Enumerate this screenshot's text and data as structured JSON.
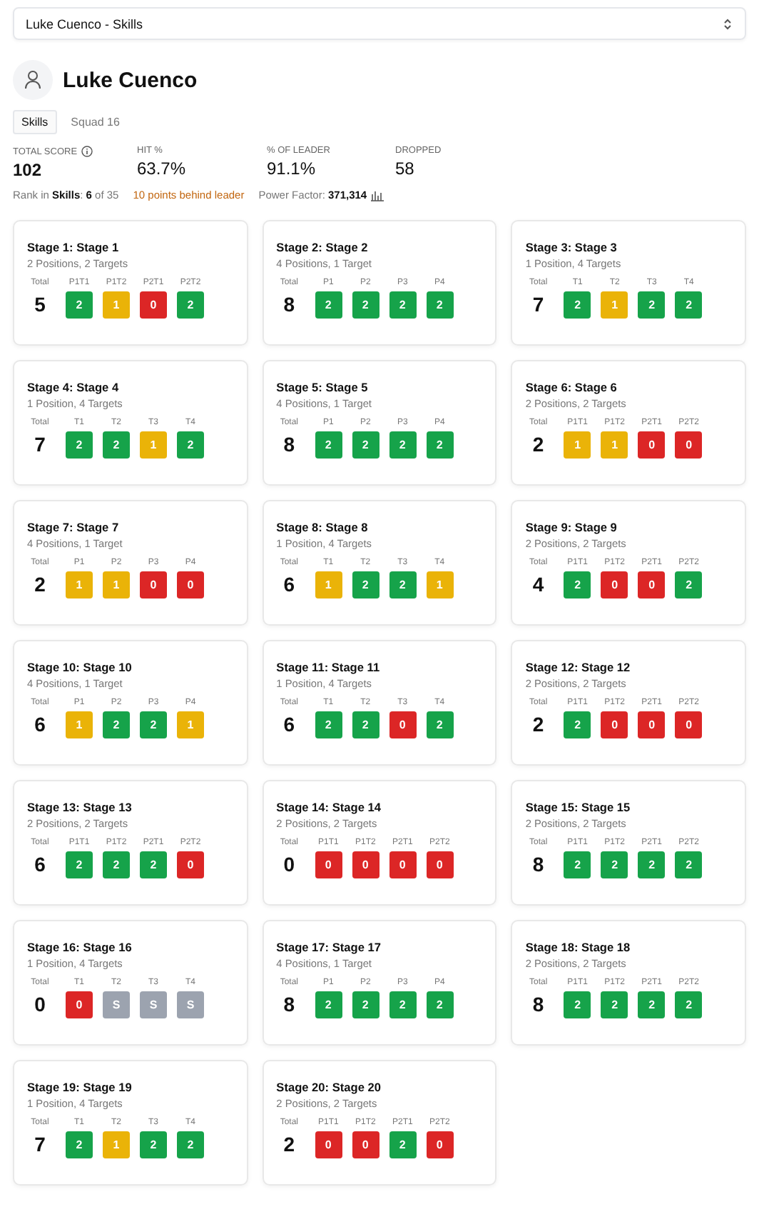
{
  "selector": {
    "value": "Luke Cuenco - Skills"
  },
  "shooter": {
    "name": "Luke Cuenco"
  },
  "tabs": [
    {
      "label": "Skills",
      "selected": true
    },
    {
      "label": "Squad 16",
      "selected": false
    }
  ],
  "stats": [
    {
      "label": "TOTAL SCORE",
      "value": "102",
      "info": true
    },
    {
      "label": "HIT %",
      "value": "63.7%",
      "info": false
    },
    {
      "label": "% OF LEADER",
      "value": "91.1%",
      "info": false
    },
    {
      "label": "DROPPED",
      "value": "58",
      "info": false
    }
  ],
  "rank": {
    "prefix": "Rank in ",
    "division": "Skills",
    "sep": ": ",
    "place": "6",
    "of": " of 35"
  },
  "behind": "10 points behind leader",
  "power_factor": {
    "label": "Power Factor: ",
    "value": "371,314"
  },
  "stages": [
    {
      "title": "Stage 1: Stage 1",
      "subtitle": "2 Positions, 2 Targets",
      "total_label": "Total",
      "total": "5",
      "scores": [
        {
          "label": "P1T1",
          "value": "2",
          "color": "#16a34a"
        },
        {
          "label": "P1T2",
          "value": "1",
          "color": "#eab308"
        },
        {
          "label": "P2T1",
          "value": "0",
          "color": "#dc2626"
        },
        {
          "label": "P2T2",
          "value": "2",
          "color": "#16a34a"
        }
      ]
    },
    {
      "title": "Stage 2: Stage 2",
      "subtitle": "4 Positions, 1 Target",
      "total_label": "Total",
      "total": "8",
      "scores": [
        {
          "label": "P1",
          "value": "2",
          "color": "#16a34a"
        },
        {
          "label": "P2",
          "value": "2",
          "color": "#16a34a"
        },
        {
          "label": "P3",
          "value": "2",
          "color": "#16a34a"
        },
        {
          "label": "P4",
          "value": "2",
          "color": "#16a34a"
        }
      ]
    },
    {
      "title": "Stage 3: Stage 3",
      "subtitle": "1 Position, 4 Targets",
      "total_label": "Total",
      "total": "7",
      "scores": [
        {
          "label": "T1",
          "value": "2",
          "color": "#16a34a"
        },
        {
          "label": "T2",
          "value": "1",
          "color": "#eab308"
        },
        {
          "label": "T3",
          "value": "2",
          "color": "#16a34a"
        },
        {
          "label": "T4",
          "value": "2",
          "color": "#16a34a"
        }
      ]
    },
    {
      "title": "Stage 4: Stage 4",
      "subtitle": "1 Position, 4 Targets",
      "total_label": "Total",
      "total": "7",
      "scores": [
        {
          "label": "T1",
          "value": "2",
          "color": "#16a34a"
        },
        {
          "label": "T2",
          "value": "2",
          "color": "#16a34a"
        },
        {
          "label": "T3",
          "value": "1",
          "color": "#eab308"
        },
        {
          "label": "T4",
          "value": "2",
          "color": "#16a34a"
        }
      ]
    },
    {
      "title": "Stage 5: Stage 5",
      "subtitle": "4 Positions, 1 Target",
      "total_label": "Total",
      "total": "8",
      "scores": [
        {
          "label": "P1",
          "value": "2",
          "color": "#16a34a"
        },
        {
          "label": "P2",
          "value": "2",
          "color": "#16a34a"
        },
        {
          "label": "P3",
          "value": "2",
          "color": "#16a34a"
        },
        {
          "label": "P4",
          "value": "2",
          "color": "#16a34a"
        }
      ]
    },
    {
      "title": "Stage 6: Stage 6",
      "subtitle": "2 Positions, 2 Targets",
      "total_label": "Total",
      "total": "2",
      "scores": [
        {
          "label": "P1T1",
          "value": "1",
          "color": "#eab308"
        },
        {
          "label": "P1T2",
          "value": "1",
          "color": "#eab308"
        },
        {
          "label": "P2T1",
          "value": "0",
          "color": "#dc2626"
        },
        {
          "label": "P2T2",
          "value": "0",
          "color": "#dc2626"
        }
      ]
    },
    {
      "title": "Stage 7: Stage 7",
      "subtitle": "4 Positions, 1 Target",
      "total_label": "Total",
      "total": "2",
      "scores": [
        {
          "label": "P1",
          "value": "1",
          "color": "#eab308"
        },
        {
          "label": "P2",
          "value": "1",
          "color": "#eab308"
        },
        {
          "label": "P3",
          "value": "0",
          "color": "#dc2626"
        },
        {
          "label": "P4",
          "value": "0",
          "color": "#dc2626"
        }
      ]
    },
    {
      "title": "Stage 8: Stage 8",
      "subtitle": "1 Position, 4 Targets",
      "total_label": "Total",
      "total": "6",
      "scores": [
        {
          "label": "T1",
          "value": "1",
          "color": "#eab308"
        },
        {
          "label": "T2",
          "value": "2",
          "color": "#16a34a"
        },
        {
          "label": "T3",
          "value": "2",
          "color": "#16a34a"
        },
        {
          "label": "T4",
          "value": "1",
          "color": "#eab308"
        }
      ]
    },
    {
      "title": "Stage 9: Stage 9",
      "subtitle": "2 Positions, 2 Targets",
      "total_label": "Total",
      "total": "4",
      "scores": [
        {
          "label": "P1T1",
          "value": "2",
          "color": "#16a34a"
        },
        {
          "label": "P1T2",
          "value": "0",
          "color": "#dc2626"
        },
        {
          "label": "P2T1",
          "value": "0",
          "color": "#dc2626"
        },
        {
          "label": "P2T2",
          "value": "2",
          "color": "#16a34a"
        }
      ]
    },
    {
      "title": "Stage 10: Stage 10",
      "subtitle": "4 Positions, 1 Target",
      "total_label": "Total",
      "total": "6",
      "scores": [
        {
          "label": "P1",
          "value": "1",
          "color": "#eab308"
        },
        {
          "label": "P2",
          "value": "2",
          "color": "#16a34a"
        },
        {
          "label": "P3",
          "value": "2",
          "color": "#16a34a"
        },
        {
          "label": "P4",
          "value": "1",
          "color": "#eab308"
        }
      ]
    },
    {
      "title": "Stage 11: Stage 11",
      "subtitle": "1 Position, 4 Targets",
      "total_label": "Total",
      "total": "6",
      "scores": [
        {
          "label": "T1",
          "value": "2",
          "color": "#16a34a"
        },
        {
          "label": "T2",
          "value": "2",
          "color": "#16a34a"
        },
        {
          "label": "T3",
          "value": "0",
          "color": "#dc2626"
        },
        {
          "label": "T4",
          "value": "2",
          "color": "#16a34a"
        }
      ]
    },
    {
      "title": "Stage 12: Stage 12",
      "subtitle": "2 Positions, 2 Targets",
      "total_label": "Total",
      "total": "2",
      "scores": [
        {
          "label": "P1T1",
          "value": "2",
          "color": "#16a34a"
        },
        {
          "label": "P1T2",
          "value": "0",
          "color": "#dc2626"
        },
        {
          "label": "P2T1",
          "value": "0",
          "color": "#dc2626"
        },
        {
          "label": "P2T2",
          "value": "0",
          "color": "#dc2626"
        }
      ]
    },
    {
      "title": "Stage 13: Stage 13",
      "subtitle": "2 Positions, 2 Targets",
      "total_label": "Total",
      "total": "6",
      "scores": [
        {
          "label": "P1T1",
          "value": "2",
          "color": "#16a34a"
        },
        {
          "label": "P1T2",
          "value": "2",
          "color": "#16a34a"
        },
        {
          "label": "P2T1",
          "value": "2",
          "color": "#16a34a"
        },
        {
          "label": "P2T2",
          "value": "0",
          "color": "#dc2626"
        }
      ]
    },
    {
      "title": "Stage 14: Stage 14",
      "subtitle": "2 Positions, 2 Targets",
      "total_label": "Total",
      "total": "0",
      "scores": [
        {
          "label": "P1T1",
          "value": "0",
          "color": "#dc2626"
        },
        {
          "label": "P1T2",
          "value": "0",
          "color": "#dc2626"
        },
        {
          "label": "P2T1",
          "value": "0",
          "color": "#dc2626"
        },
        {
          "label": "P2T2",
          "value": "0",
          "color": "#dc2626"
        }
      ]
    },
    {
      "title": "Stage 15: Stage 15",
      "subtitle": "2 Positions, 2 Targets",
      "total_label": "Total",
      "total": "8",
      "scores": [
        {
          "label": "P1T1",
          "value": "2",
          "color": "#16a34a"
        },
        {
          "label": "P1T2",
          "value": "2",
          "color": "#16a34a"
        },
        {
          "label": "P2T1",
          "value": "2",
          "color": "#16a34a"
        },
        {
          "label": "P2T2",
          "value": "2",
          "color": "#16a34a"
        }
      ]
    },
    {
      "title": "Stage 16: Stage 16",
      "subtitle": "1 Position, 4 Targets",
      "total_label": "Total",
      "total": "0",
      "scores": [
        {
          "label": "T1",
          "value": "0",
          "color": "#dc2626"
        },
        {
          "label": "T2",
          "value": "S",
          "color": "#9ca3af"
        },
        {
          "label": "T3",
          "value": "S",
          "color": "#9ca3af"
        },
        {
          "label": "T4",
          "value": "S",
          "color": "#9ca3af"
        }
      ]
    },
    {
      "title": "Stage 17: Stage 17",
      "subtitle": "4 Positions, 1 Target",
      "total_label": "Total",
      "total": "8",
      "scores": [
        {
          "label": "P1",
          "value": "2",
          "color": "#16a34a"
        },
        {
          "label": "P2",
          "value": "2",
          "color": "#16a34a"
        },
        {
          "label": "P3",
          "value": "2",
          "color": "#16a34a"
        },
        {
          "label": "P4",
          "value": "2",
          "color": "#16a34a"
        }
      ]
    },
    {
      "title": "Stage 18: Stage 18",
      "subtitle": "2 Positions, 2 Targets",
      "total_label": "Total",
      "total": "8",
      "scores": [
        {
          "label": "P1T1",
          "value": "2",
          "color": "#16a34a"
        },
        {
          "label": "P1T2",
          "value": "2",
          "color": "#16a34a"
        },
        {
          "label": "P2T1",
          "value": "2",
          "color": "#16a34a"
        },
        {
          "label": "P2T2",
          "value": "2",
          "color": "#16a34a"
        }
      ]
    },
    {
      "title": "Stage 19: Stage 19",
      "subtitle": "1 Position, 4 Targets",
      "total_label": "Total",
      "total": "7",
      "scores": [
        {
          "label": "T1",
          "value": "2",
          "color": "#16a34a"
        },
        {
          "label": "T2",
          "value": "1",
          "color": "#eab308"
        },
        {
          "label": "T3",
          "value": "2",
          "color": "#16a34a"
        },
        {
          "label": "T4",
          "value": "2",
          "color": "#16a34a"
        }
      ]
    },
    {
      "title": "Stage 20: Stage 20",
      "subtitle": "2 Positions, 2 Targets",
      "total_label": "Total",
      "total": "2",
      "scores": [
        {
          "label": "P1T1",
          "value": "0",
          "color": "#dc2626"
        },
        {
          "label": "P1T2",
          "value": "0",
          "color": "#dc2626"
        },
        {
          "label": "P2T1",
          "value": "2",
          "color": "#16a34a"
        },
        {
          "label": "P2T2",
          "value": "0",
          "color": "#dc2626"
        }
      ]
    }
  ]
}
